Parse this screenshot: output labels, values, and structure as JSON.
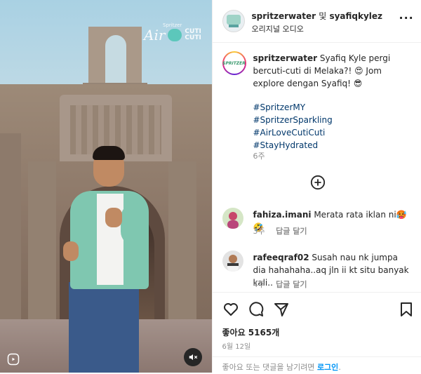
{
  "media": {
    "logo_air": "Air",
    "logo_cuti_1": "CUTI",
    "logo_cuti_2": "CUTI",
    "logo_brand": "Spritzer"
  },
  "header": {
    "username": "spritzerwater",
    "connector": "및",
    "collaborator": "syafiqkylez",
    "audio": "오리지널 오디오",
    "more": "···"
  },
  "caption": {
    "username": "spritzerwater",
    "text": "Syafiq Kyle pergi bercuti-cuti di Melaka?! 😍 Jom explore dengan Syafiq! 😎",
    "hashtags": [
      "#SpritzerMY",
      "#SpritzerSparkling",
      "#AirLoveCutiCuti",
      "#StayHydrated"
    ],
    "time": "6주",
    "avatar_mark": "SPRITZER"
  },
  "comments": [
    {
      "username": "fahiza.imani",
      "text": "Merata rata iklan ni🥵 🤣",
      "time": "3주",
      "reply": "답글 달기"
    },
    {
      "username": "rafeeqraf02",
      "text": "Susah nau nk jumpa dia hahahaha..aq jln ii kt situ banyak kali..",
      "time": "4주",
      "reply": "답글 달기"
    }
  ],
  "footer": {
    "likes": "좋아요 5165개",
    "date": "6월 12일",
    "comment_prompt": "좋아요 또는 댓글을 남기려면",
    "login": "로그인",
    "period": "."
  },
  "colors": {
    "link": "#00376b",
    "login": "#0095f6",
    "muted": "#8e8e8e",
    "text": "#262626"
  }
}
